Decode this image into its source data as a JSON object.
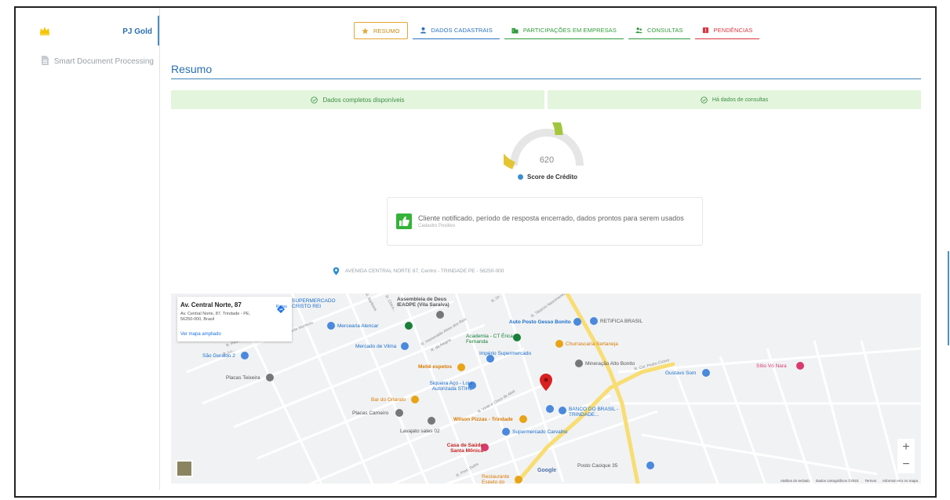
{
  "sidebar": {
    "items": [
      {
        "label": "PJ Gold",
        "icon": "crown-icon"
      },
      {
        "label": "Smart Document Processing",
        "icon": "document-icon"
      }
    ]
  },
  "tabs": [
    {
      "label": "RESUMO",
      "icon": "star-icon"
    },
    {
      "label": "DADOS CADASTRAIS",
      "icon": "user-icon"
    },
    {
      "label": "PARTICIPAÇÕES EM EMPRESAS",
      "icon": "building-icon"
    },
    {
      "label": "CONSULTAS",
      "icon": "people-icon"
    },
    {
      "label": "PENDÊNCIAS",
      "icon": "alert-icon"
    }
  ],
  "section_title": "Resumo",
  "status": {
    "left": "Dados completos disponíveis",
    "right": "Há dados de consultas"
  },
  "score": {
    "value": "620",
    "label": "Score de Crédito",
    "level": 0.62
  },
  "notice": {
    "text": "Cliente notificado, período de resposta encerrado, dados prontos para serem usados",
    "sub": "Cadastro Positivo"
  },
  "address": "AVENIDA CENTRAL NORTE 87, Centro - TRINDADE PE - 56250-000",
  "map": {
    "card": {
      "title": "Av. Central Norte, 87",
      "address": "Av. Central Norte, 87, Trindade - PE, 56250-000, Brasil",
      "link": "Ver mapa ampliado",
      "directions": "Rotas"
    },
    "labels": {
      "supermercado": "SUPERMERCADO CRISTO REI",
      "assembleia": "Assembleia de Deus IEADPE (Vila Saraiva)",
      "mercearia": "Mercearia Alencar",
      "auto_posto": "Auto Posto Gesso Bonito",
      "retifica": "RETIFICA BRASIL",
      "mercado_vilma": "Mercado de Vilma",
      "academia": "Academia - CT Érica Fernanda",
      "churrascaria": "Churrascaria Sertaneja",
      "sao_geraldo": "São Geraldo 2",
      "imperio": "Império Supermercado",
      "metie": "Metiê espetos",
      "mineracao": "Mineração Alto Bonito",
      "gustavo": "Gustavo Som",
      "sitio": "Sítio Vó Nara",
      "placas_teixeira": "Placas Teixeira",
      "siqueira": "Siqueira Aço - Loja Autorizada STIHL",
      "bar_orlando": "Bar do Orlando",
      "placas_carneiro": "Placas Carneiro",
      "banco": "BANCO DO BRASIL - TRINDADE...",
      "wilson": "Wilson Pizzas - Trindade",
      "lavajato": "Lavajato sales 02",
      "supermercado_carvalho": "Supermercado Carvalho",
      "casa_saude": "Casa de Saúde Santa Mônica",
      "posto_cacique": "Posto Cacique 35",
      "restaurante": "Restaurante Espeto do Barão"
    },
    "streets": [
      "R. Pedro Leite Monteiro",
      "R. Homevaldo Alves dos Reis",
      "R. da Alegria",
      "R. Vinte e Cinco de Abril",
      "R. Cel. Pedro Cícero",
      "R. Tibúrcio Nascimento",
      "R. Pres. Dutra",
      "R. Pedr...",
      "R. Lu...",
      "R. Chico...",
      "R. Barbosa",
      "R. Dr."
    ],
    "zoom_in": "+",
    "zoom_out": "−",
    "google": "Google",
    "attribution": {
      "shortcuts": "Atalhos do teclado",
      "data": "Dados cartográficos ©2023",
      "terms": "Termos",
      "report": "Informar erro no mapa"
    }
  },
  "colors": {
    "accent_blue": "#2a6fb0",
    "status_green_bg": "#e3f5dc",
    "gauge_yellow": "#f2c531",
    "gauge_green": "#8dc63f",
    "thumb_green": "#35b338",
    "pin_red": "#d92020"
  }
}
